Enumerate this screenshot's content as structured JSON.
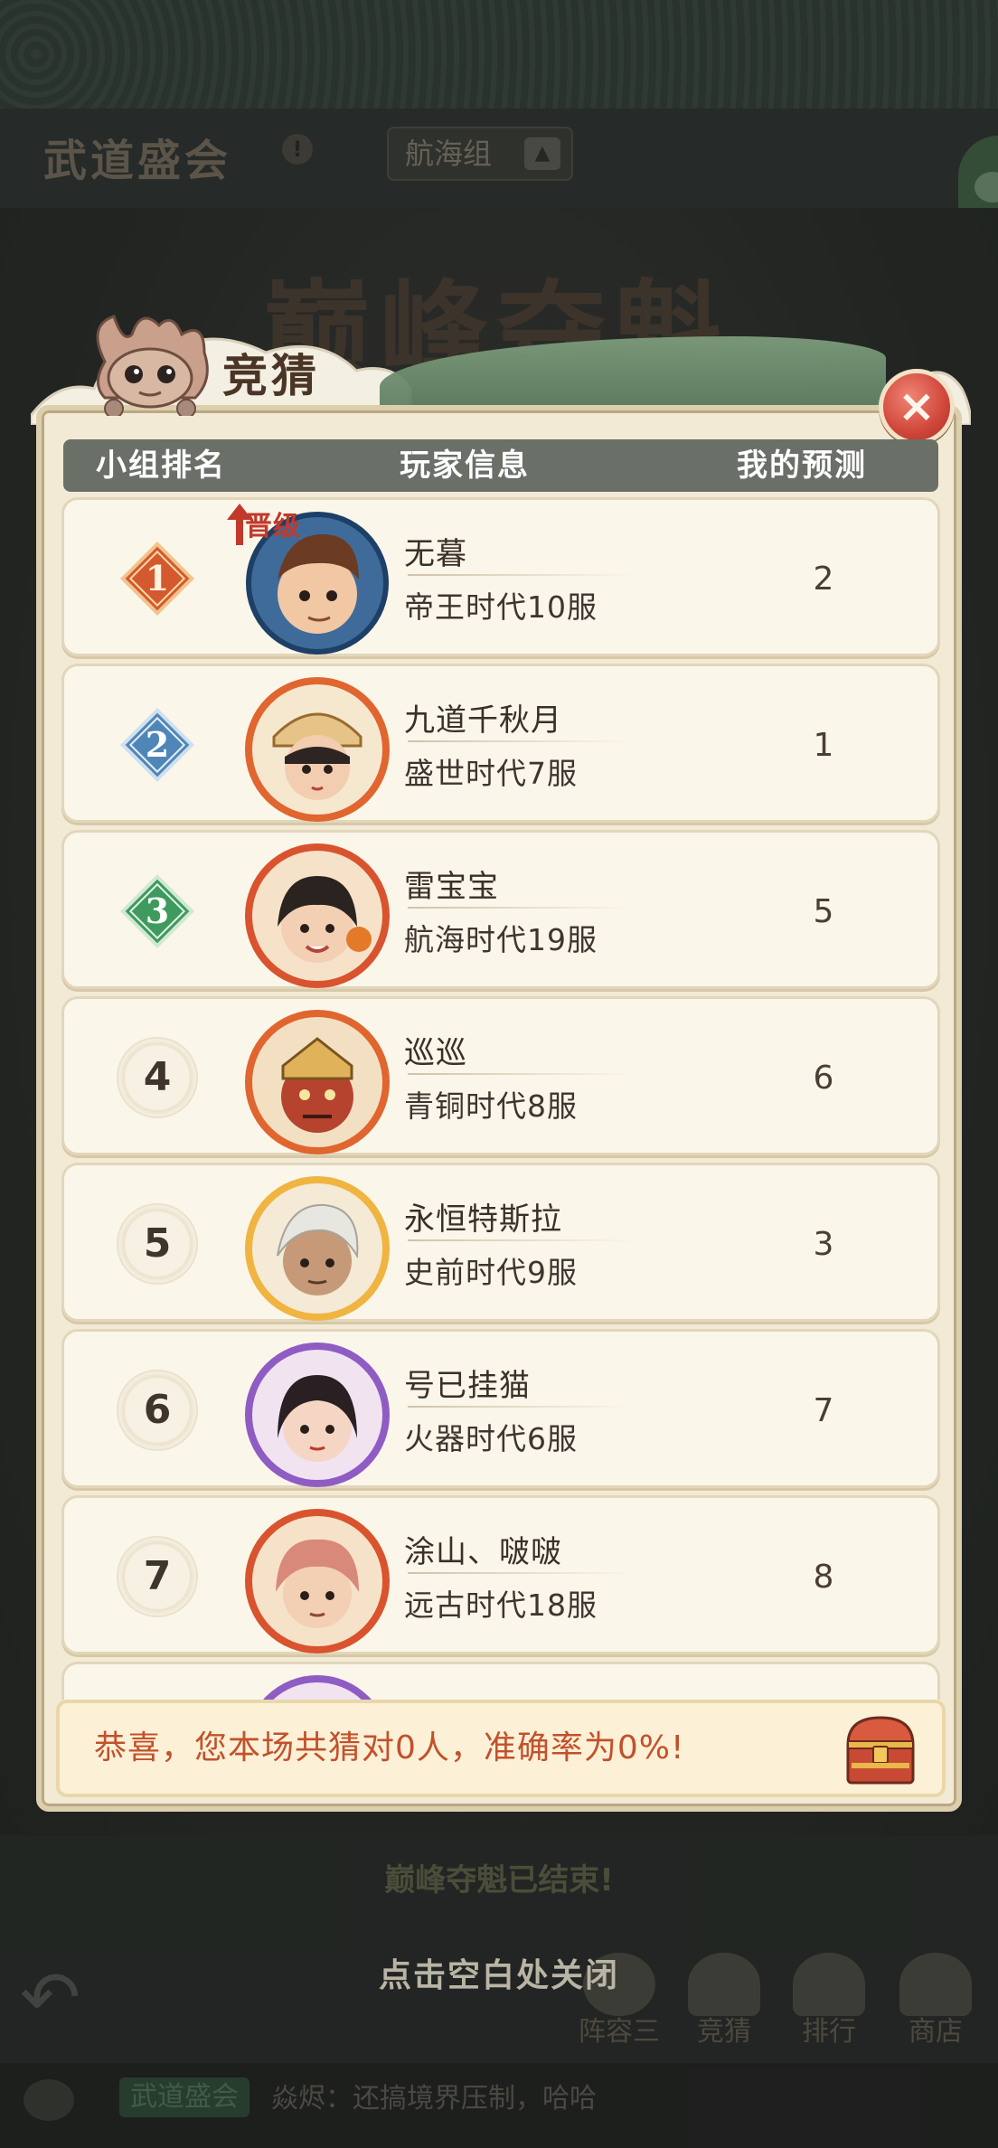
{
  "background": {
    "title": "武道盛会",
    "info_icon_glyph": "!",
    "group_selector": "航海组",
    "banner_text": "巅峰夺魁",
    "ended_text": "巅峰夺魁已结束!",
    "nav": [
      {
        "label": "阵容三"
      },
      {
        "label": "竞猜"
      },
      {
        "label": "排行"
      },
      {
        "label": "商店"
      }
    ],
    "chat": {
      "channel": "武道盛会",
      "message": "焱烬：还搞境界压制，哈哈"
    }
  },
  "popup": {
    "title": "竞猜",
    "close_glyph": "×",
    "columns": {
      "rank": "小组排名",
      "player": "玩家信息",
      "prediction": "我的预测"
    },
    "rows": [
      {
        "rank": "1",
        "name": "无暮",
        "server": "帝王时代10服",
        "prediction": "2",
        "promoted": "晋级",
        "badge_color": "#d4592f"
      },
      {
        "rank": "2",
        "name": "九道千秋月",
        "server": "盛世时代7服",
        "prediction": "1",
        "badge_color": "#4f86b8"
      },
      {
        "rank": "3",
        "name": "雷宝宝",
        "server": "航海时代19服",
        "prediction": "5",
        "badge_color": "#3e9a5d"
      },
      {
        "rank": "4",
        "name": "巡巡",
        "server": "青铜时代8服",
        "prediction": "6"
      },
      {
        "rank": "5",
        "name": "永恒特斯拉",
        "server": "史前时代9服",
        "prediction": "3"
      },
      {
        "rank": "6",
        "name": "号已挂猫",
        "server": "火器时代6服",
        "prediction": "7"
      },
      {
        "rank": "7",
        "name": "涂山、啵啵",
        "server": "远古时代18服",
        "prediction": "8"
      }
    ],
    "result": "恭喜，您本场共猜对0人，准确率为0%!"
  },
  "close_hint": "点击空白处关闭",
  "colors": {
    "panel_bg": "#f3ead6",
    "header_bg": "#6a6f68",
    "result_text": "#c2512c",
    "close_button": "#d0463a"
  }
}
